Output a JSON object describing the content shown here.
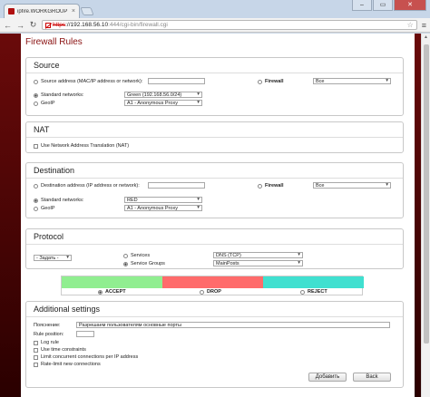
{
  "browser": {
    "tab_title": "ipfire.WORKGROUP - Ros",
    "url_protocol": "https",
    "url_host": "://192.168.56.10",
    "url_path": ":444/cgi-bin/firewall.cgi",
    "window_buttons": {
      "minimize": "–",
      "maximize": "▭",
      "close": "✕"
    }
  },
  "page": {
    "title": "Firewall Rules",
    "source": {
      "heading": "Source",
      "address_label": "Source address (MAC/IP address or network):",
      "address_value": "",
      "firewall_label": "Firewall",
      "firewall_select": "Все",
      "standard_networks_label": "Standard networks:",
      "standard_networks_select": "Green (192.168.56.0/24)",
      "geoip_label": "GeoIP",
      "geoip_select": "A1 - Anonymous Proxy"
    },
    "nat": {
      "heading": "NAT",
      "use_nat_label": "Use Network Address Translation (NAT)"
    },
    "destination": {
      "heading": "Destination",
      "address_label": "Destination address (IP address or network):",
      "address_value": "",
      "firewall_label": "Firewall",
      "firewall_select": "Все",
      "standard_networks_label": "Standard networks:",
      "standard_networks_select": "RED",
      "geoip_label": "GeoIP",
      "geoip_select": "A1 - Anonymous Proxy"
    },
    "protocol": {
      "heading": "Protocol",
      "protocol_select": "- Задать -",
      "services_label": "Services",
      "services_select": "DNS (TCP)",
      "service_groups_label": "Service Groups",
      "service_groups_select": "MainPosts"
    },
    "action": {
      "accept_label": "ACCEPT",
      "drop_label": "DROP",
      "reject_label": "REJECT",
      "accept_color": "#90ee90",
      "drop_color": "#ff6b6b",
      "reject_color": "#40e0d0"
    },
    "additional": {
      "heading": "Additional settings",
      "remark_label": "Пояснение:",
      "remark_value": "Разрешаем пользователям основные порты",
      "rule_position_label": "Rule position:",
      "rule_position_value": "",
      "log_rule_label": "Log rule",
      "use_time_label": "Use time constraints",
      "limit_concurrent_label": "Limit concurrent connections per IP address",
      "rate_limit_label": "Rate-limit new connections",
      "add_button": "Добавить",
      "back_button": "Back"
    }
  }
}
